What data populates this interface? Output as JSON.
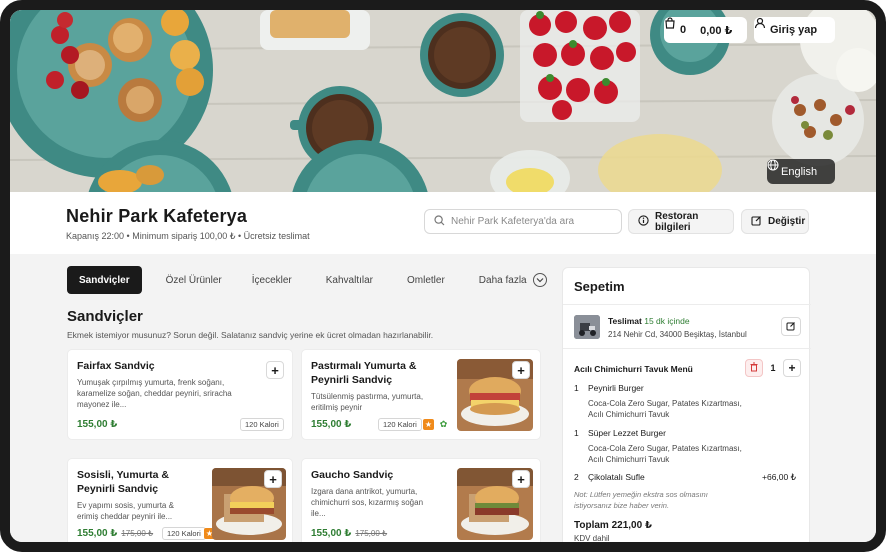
{
  "header": {
    "cart_count": "0",
    "cart_total": "0,00 ₺",
    "login_label": "Giriş yap",
    "language_label": "English"
  },
  "restaurant": {
    "name": "Nehir Park Kafeterya",
    "meta": "Kapanış 22:00 • Minimum sipariş 100,00 ₺ • Ücretsiz teslimat",
    "search_placeholder": "Nehir Park Kafeterya'da ara",
    "info_label": "Restoran bilgileri",
    "edit_label": "Değiştir"
  },
  "tabs": [
    {
      "label": "Sandviçler",
      "active": true
    },
    {
      "label": "Özel Ürünler"
    },
    {
      "label": "İçecekler"
    },
    {
      "label": "Kahvaltılar"
    },
    {
      "label": "Omletler"
    },
    {
      "label": "Daha fazla"
    }
  ],
  "section": {
    "title": "Sandviçler",
    "description": "Ekmek istemiyor musunuz? Sorun değil. Salatanız sandviç yerine ek ücret olmadan hazırlanabilir."
  },
  "products": [
    {
      "title": "Fairfax Sandviç",
      "description": [
        "Yumuşak çırpılmış yumurta, frenk soğanı,",
        "karamelize soğan, cheddar peyniri, sriracha",
        "mayonez ile..."
      ],
      "price": "155,00 ₺",
      "calories": "120 Kalori"
    },
    {
      "title": [
        "Pastırmalı Yumurta &",
        "Peynirli Sandviç"
      ],
      "description": [
        "Tütsülenmiş pastırma, yumurta,",
        "eritilmiş peynir"
      ],
      "price": "155,00 ₺",
      "calories": "120 Kalori"
    },
    {
      "title": [
        "Sosisli, Yumurta &",
        "Peynirli Sandviç"
      ],
      "description": [
        "Ev yapımı sosis, yumurta &",
        "erimiş cheddar peyniri ile..."
      ],
      "price": "155,00 ₺",
      "old_price": "175,00 ₺",
      "calories": "120 Kalori"
    },
    {
      "title": "Gaucho Sandviç",
      "description": [
        "Izgara dana antrikot, yumurta,",
        "chimichurri sos, kızarmış soğan",
        "ile..."
      ],
      "price": "155,00 ₺",
      "old_price": "175,00 ₺"
    }
  ],
  "cart": {
    "title": "Sepetim",
    "delivery_label": "Teslimat",
    "delivery_time": "15 dk içinde",
    "address": "214 Nehir Cd, 34000 Beşiktaş, İstanbul",
    "menu_title": "Acılı Chimichurri Tavuk Menü",
    "menu_qty": "1",
    "items": [
      {
        "qty": "1",
        "name": "Peynirli Burger",
        "options": [
          "Coca-Cola Zero Sugar, Patates Kızartması,",
          "Acılı Chimichurri Tavuk"
        ]
      },
      {
        "qty": "1",
        "name": "Süper Lezzet Burger",
        "options": [
          "Coca-Cola Zero Sugar, Patates Kızartması,",
          "Acılı Chimichurri Tavuk"
        ]
      },
      {
        "qty": "2",
        "name": "Çikolatalı Sufle",
        "price": "+66,00 ₺"
      }
    ],
    "note": [
      "Not: Lütfen yemeğin ekstra sos olmasını",
      "istiyorsanız bize haber verin."
    ],
    "total": "Toplam 221,00 ₺",
    "vat": "KDV dahil"
  },
  "colors": {
    "accent_green": "#2e7d32",
    "dark": "#1a1a1a",
    "badge_orange": "#f08a1a"
  }
}
